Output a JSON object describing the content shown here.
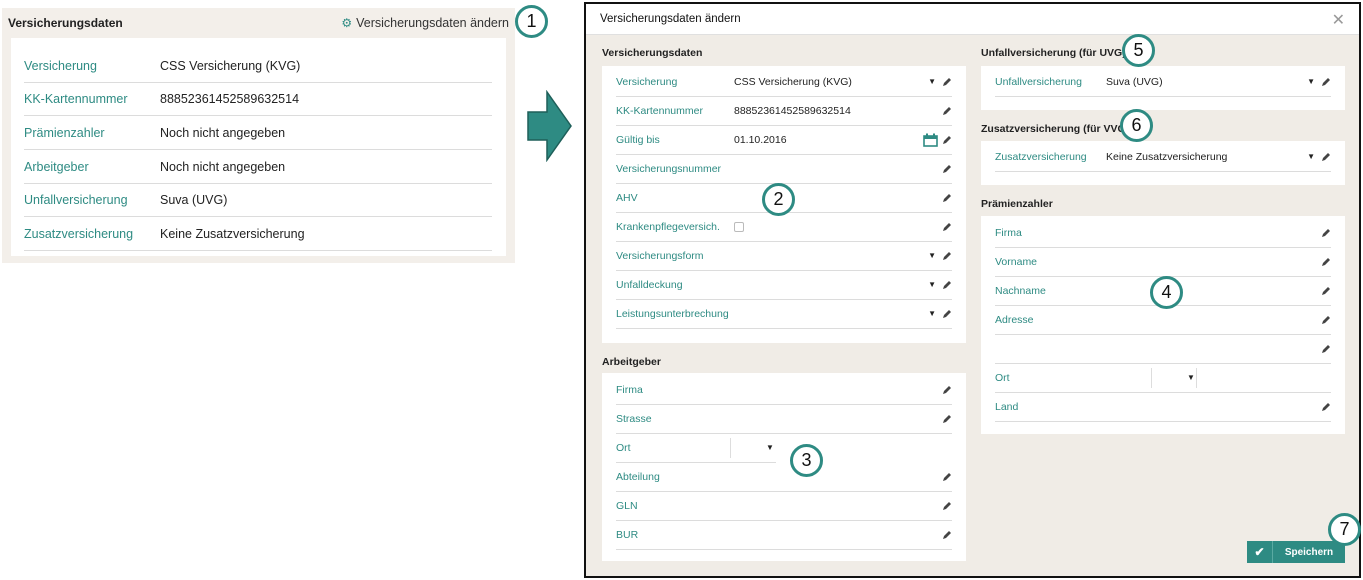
{
  "summary": {
    "title": "Versicherungsdaten",
    "change_label": "Versicherungsdaten ändern",
    "rows": [
      {
        "label": "Versicherung",
        "value": "CSS Versicherung (KVG)"
      },
      {
        "label": "KK-Kartennummer",
        "value": "88852361452589632514"
      },
      {
        "label": "Prämienzahler",
        "value": "Noch nicht angegeben"
      },
      {
        "label": "Arbeitgeber",
        "value": "Noch nicht angegeben"
      },
      {
        "label": "Unfallversicherung",
        "value": "Suva (UVG)"
      },
      {
        "label": "Zusatzversicherung",
        "value": "Keine Zusatzversicherung"
      }
    ]
  },
  "badges": [
    "1",
    "2",
    "3",
    "4",
    "5",
    "6",
    "7"
  ],
  "modal": {
    "title": "Versicherungsdaten ändern",
    "close": "✕",
    "versicherungsdaten": {
      "title": "Versicherungsdaten",
      "fields": [
        {
          "label": "Versicherung",
          "value": "CSS Versicherung (KVG)"
        },
        {
          "label": "KK-Kartennummer",
          "value": "88852361452589632514"
        },
        {
          "label": "Gültig bis",
          "value": "01.10.2016"
        },
        {
          "label": "Versicherungsnummer",
          "value": ""
        },
        {
          "label": "AHV",
          "value": ""
        },
        {
          "label": "Krankenpflegeversich.",
          "value": ""
        },
        {
          "label": "Versicherungsform",
          "value": ""
        },
        {
          "label": "Unfalldeckung",
          "value": ""
        },
        {
          "label": "Leistungsunterbrechung",
          "value": ""
        }
      ]
    },
    "arbeitgeber": {
      "title": "Arbeitgeber",
      "fields": [
        {
          "label": "Firma"
        },
        {
          "label": "Strasse"
        },
        {
          "label": "Ort"
        },
        {
          "label": "Abteilung"
        },
        {
          "label": "GLN"
        },
        {
          "label": "BUR"
        }
      ]
    },
    "unfallversicherung": {
      "title": "Unfallversicherung (für UVG)",
      "label": "Unfallversicherung",
      "value": "Suva (UVG)"
    },
    "zusatzversicherung": {
      "title": "Zusatzversicherung (für VVG)",
      "label": "Zusatzversicherung",
      "value": "Keine Zusatzversicherung"
    },
    "praemienzahler": {
      "title": "Prämienzahler",
      "fields": [
        {
          "label": "Firma"
        },
        {
          "label": "Vorname"
        },
        {
          "label": "Nachname"
        },
        {
          "label": "Adresse"
        },
        {
          "label": ""
        },
        {
          "label": "Ort"
        },
        {
          "label": "Land"
        }
      ]
    },
    "save_label": "Speichern"
  },
  "colors": {
    "accent": "#2e8b83",
    "panel_bg": "#f3efea",
    "modal_bg": "#f0ece6"
  }
}
